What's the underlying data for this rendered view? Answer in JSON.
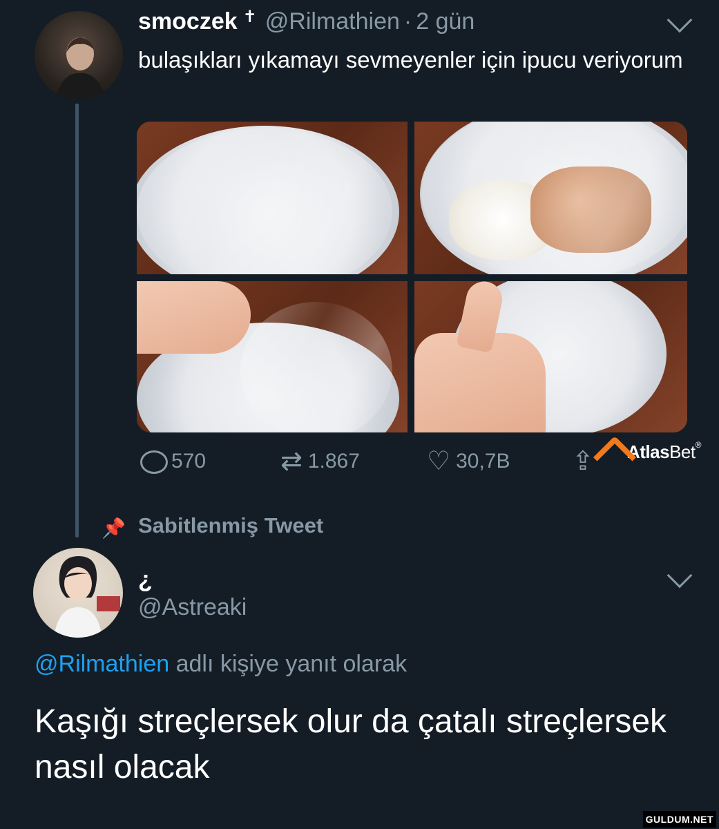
{
  "tweet1": {
    "name": "smoczek",
    "name_symbol": "✝",
    "handle": "@Rilmathien",
    "separator": "·",
    "time": "2 gün",
    "text": "bulaşıkları yıkamayı sevmeyenler için ipucu veriyorum",
    "actions": {
      "reply_count": "570",
      "retweet_count": "1.867",
      "like_count": "30,7B"
    },
    "images": [
      "plate-wrapped",
      "plate-with-food",
      "peeling-wrap",
      "thumbs-up-clean-plate"
    ]
  },
  "pinned_label": "Sabitlenmiş Tweet",
  "tweet2": {
    "name": "¿",
    "handle": "@Astreaki",
    "reply_to_mention": "@Rilmathien",
    "reply_to_suffix": "adlı kişiye yanıt olarak",
    "text": "Kaşığı streçlersek olur da çatalı streçlersek nasıl olacak"
  },
  "ad_logo": {
    "bold": "Atlas",
    "light": "Bet",
    "reg": "®"
  },
  "watermark": "GULDUM.NET",
  "colors": {
    "background": "#141d26",
    "secondary_text": "#8899a6",
    "link": "#1da1f2",
    "brand_orange": "#f07b1e"
  }
}
